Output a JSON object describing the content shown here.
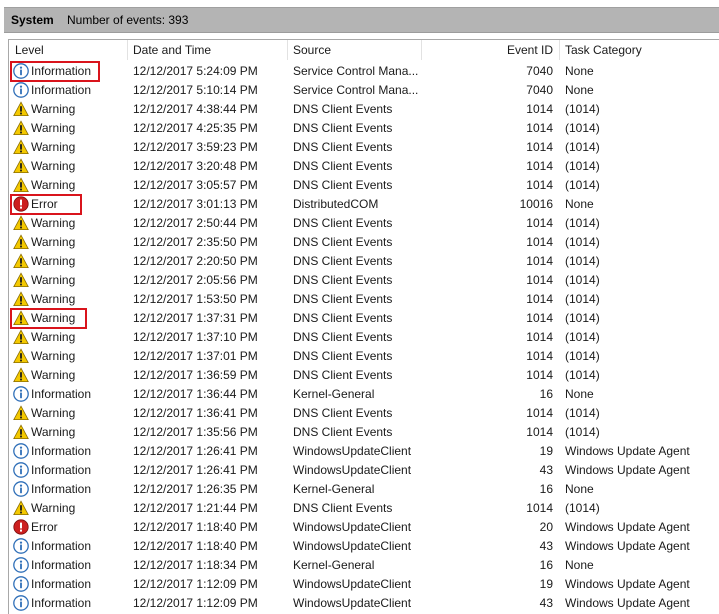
{
  "header": {
    "log_name": "System",
    "event_count": "Number of events: 393"
  },
  "columns": {
    "level": "Level",
    "date": "Date and Time",
    "source": "Source",
    "event_id": "Event ID",
    "task": "Task Category"
  },
  "icon_names": {
    "Information": "information-icon",
    "Warning": "warning-icon",
    "Error": "error-icon"
  },
  "highlighted_rows": [
    0,
    7,
    13
  ],
  "colors": {
    "highlight_box": "#d9141c",
    "info_icon": "#2f6fb8",
    "warning_icon": "#f4c900",
    "error_icon": "#cc1f1f"
  },
  "events": [
    {
      "level": "Information",
      "date": "12/12/2017 5:24:09 PM",
      "source": "Service Control Mana...",
      "event_id": "7040",
      "task": "None"
    },
    {
      "level": "Information",
      "date": "12/12/2017 5:10:14 PM",
      "source": "Service Control Mana...",
      "event_id": "7040",
      "task": "None"
    },
    {
      "level": "Warning",
      "date": "12/12/2017 4:38:44 PM",
      "source": "DNS Client Events",
      "event_id": "1014",
      "task": "(1014)"
    },
    {
      "level": "Warning",
      "date": "12/12/2017 4:25:35 PM",
      "source": "DNS Client Events",
      "event_id": "1014",
      "task": "(1014)"
    },
    {
      "level": "Warning",
      "date": "12/12/2017 3:59:23 PM",
      "source": "DNS Client Events",
      "event_id": "1014",
      "task": "(1014)"
    },
    {
      "level": "Warning",
      "date": "12/12/2017 3:20:48 PM",
      "source": "DNS Client Events",
      "event_id": "1014",
      "task": "(1014)"
    },
    {
      "level": "Warning",
      "date": "12/12/2017 3:05:57 PM",
      "source": "DNS Client Events",
      "event_id": "1014",
      "task": "(1014)"
    },
    {
      "level": "Error",
      "date": "12/12/2017 3:01:13 PM",
      "source": "DistributedCOM",
      "event_id": "10016",
      "task": "None"
    },
    {
      "level": "Warning",
      "date": "12/12/2017 2:50:44 PM",
      "source": "DNS Client Events",
      "event_id": "1014",
      "task": "(1014)"
    },
    {
      "level": "Warning",
      "date": "12/12/2017 2:35:50 PM",
      "source": "DNS Client Events",
      "event_id": "1014",
      "task": "(1014)"
    },
    {
      "level": "Warning",
      "date": "12/12/2017 2:20:50 PM",
      "source": "DNS Client Events",
      "event_id": "1014",
      "task": "(1014)"
    },
    {
      "level": "Warning",
      "date": "12/12/2017 2:05:56 PM",
      "source": "DNS Client Events",
      "event_id": "1014",
      "task": "(1014)"
    },
    {
      "level": "Warning",
      "date": "12/12/2017 1:53:50 PM",
      "source": "DNS Client Events",
      "event_id": "1014",
      "task": "(1014)"
    },
    {
      "level": "Warning",
      "date": "12/12/2017 1:37:31 PM",
      "source": "DNS Client Events",
      "event_id": "1014",
      "task": "(1014)"
    },
    {
      "level": "Warning",
      "date": "12/12/2017 1:37:10 PM",
      "source": "DNS Client Events",
      "event_id": "1014",
      "task": "(1014)"
    },
    {
      "level": "Warning",
      "date": "12/12/2017 1:37:01 PM",
      "source": "DNS Client Events",
      "event_id": "1014",
      "task": "(1014)"
    },
    {
      "level": "Warning",
      "date": "12/12/2017 1:36:59 PM",
      "source": "DNS Client Events",
      "event_id": "1014",
      "task": "(1014)"
    },
    {
      "level": "Information",
      "date": "12/12/2017 1:36:44 PM",
      "source": "Kernel-General",
      "event_id": "16",
      "task": "None"
    },
    {
      "level": "Warning",
      "date": "12/12/2017 1:36:41 PM",
      "source": "DNS Client Events",
      "event_id": "1014",
      "task": "(1014)"
    },
    {
      "level": "Warning",
      "date": "12/12/2017 1:35:56 PM",
      "source": "DNS Client Events",
      "event_id": "1014",
      "task": "(1014)"
    },
    {
      "level": "Information",
      "date": "12/12/2017 1:26:41 PM",
      "source": "WindowsUpdateClient",
      "event_id": "19",
      "task": "Windows Update Agent"
    },
    {
      "level": "Information",
      "date": "12/12/2017 1:26:41 PM",
      "source": "WindowsUpdateClient",
      "event_id": "43",
      "task": "Windows Update Agent"
    },
    {
      "level": "Information",
      "date": "12/12/2017 1:26:35 PM",
      "source": "Kernel-General",
      "event_id": "16",
      "task": "None"
    },
    {
      "level": "Warning",
      "date": "12/12/2017 1:21:44 PM",
      "source": "DNS Client Events",
      "event_id": "1014",
      "task": "(1014)"
    },
    {
      "level": "Error",
      "date": "12/12/2017 1:18:40 PM",
      "source": "WindowsUpdateClient",
      "event_id": "20",
      "task": "Windows Update Agent"
    },
    {
      "level": "Information",
      "date": "12/12/2017 1:18:40 PM",
      "source": "WindowsUpdateClient",
      "event_id": "43",
      "task": "Windows Update Agent"
    },
    {
      "level": "Information",
      "date": "12/12/2017 1:18:34 PM",
      "source": "Kernel-General",
      "event_id": "16",
      "task": "None"
    },
    {
      "level": "Information",
      "date": "12/12/2017 1:12:09 PM",
      "source": "WindowsUpdateClient",
      "event_id": "19",
      "task": "Windows Update Agent"
    },
    {
      "level": "Information",
      "date": "12/12/2017 1:12:09 PM",
      "source": "WindowsUpdateClient",
      "event_id": "43",
      "task": "Windows Update Agent"
    }
  ]
}
